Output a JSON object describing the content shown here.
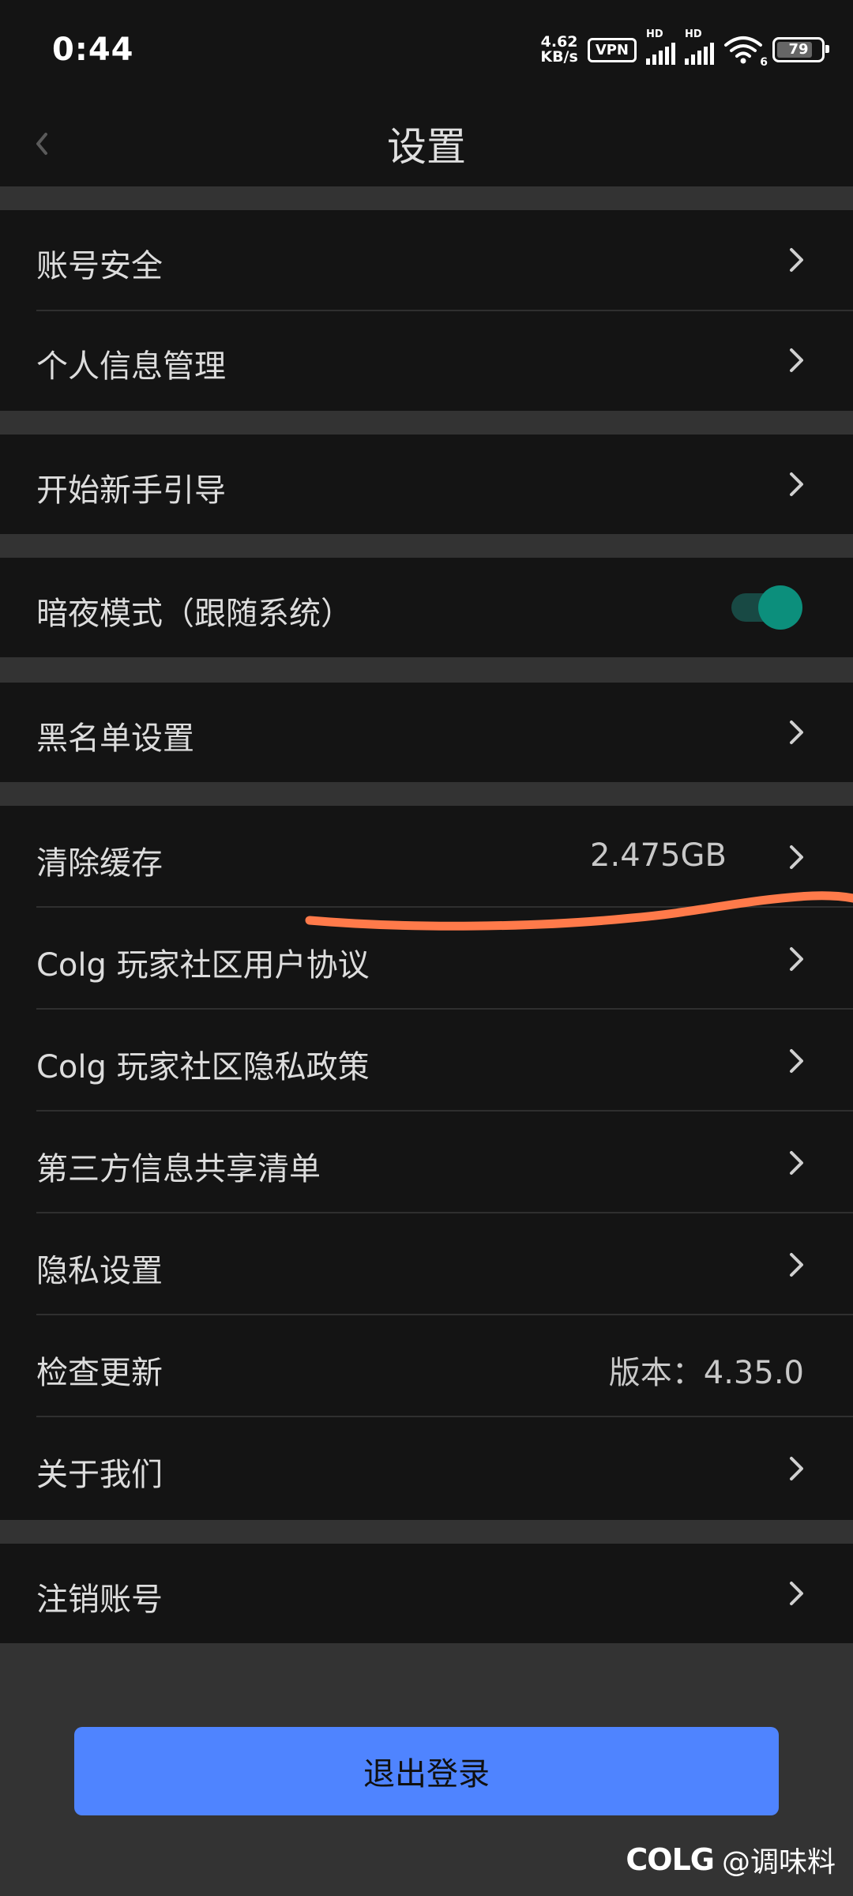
{
  "status_bar": {
    "time": "0:44",
    "net_speed_value": "4.62",
    "net_speed_unit": "KB/s",
    "vpn_label": "VPN",
    "signal_label": "HD",
    "wifi_label": "6",
    "battery_level": "79"
  },
  "header": {
    "title": "设置"
  },
  "groups": [
    {
      "items": [
        {
          "label": "账号安全"
        },
        {
          "label": "个人信息管理"
        }
      ]
    },
    {
      "items": [
        {
          "label": "开始新手引导"
        }
      ]
    },
    {
      "items": [
        {
          "label": "暗夜模式（跟随系统）",
          "toggle_on": true
        }
      ]
    },
    {
      "items": [
        {
          "label": "黑名单设置"
        }
      ]
    },
    {
      "items": [
        {
          "label": "清除缓存",
          "value": "2.475GB"
        },
        {
          "label": "Colg 玩家社区用户协议"
        },
        {
          "label": "Colg 玩家社区隐私政策"
        },
        {
          "label": "第三方信息共享清单"
        },
        {
          "label": "隐私设置"
        },
        {
          "label": "检查更新",
          "value": "版本：4.35.0"
        },
        {
          "label": "关于我们"
        }
      ]
    },
    {
      "items": [
        {
          "label": "注销账号"
        }
      ]
    }
  ],
  "logout_label": "退出登录",
  "watermark": {
    "logo": "COLG",
    "text": "@调味料"
  },
  "colors": {
    "accent": "#4f84ff",
    "toggle": "#0c8f7c",
    "annotation": "#ff7a4a"
  }
}
